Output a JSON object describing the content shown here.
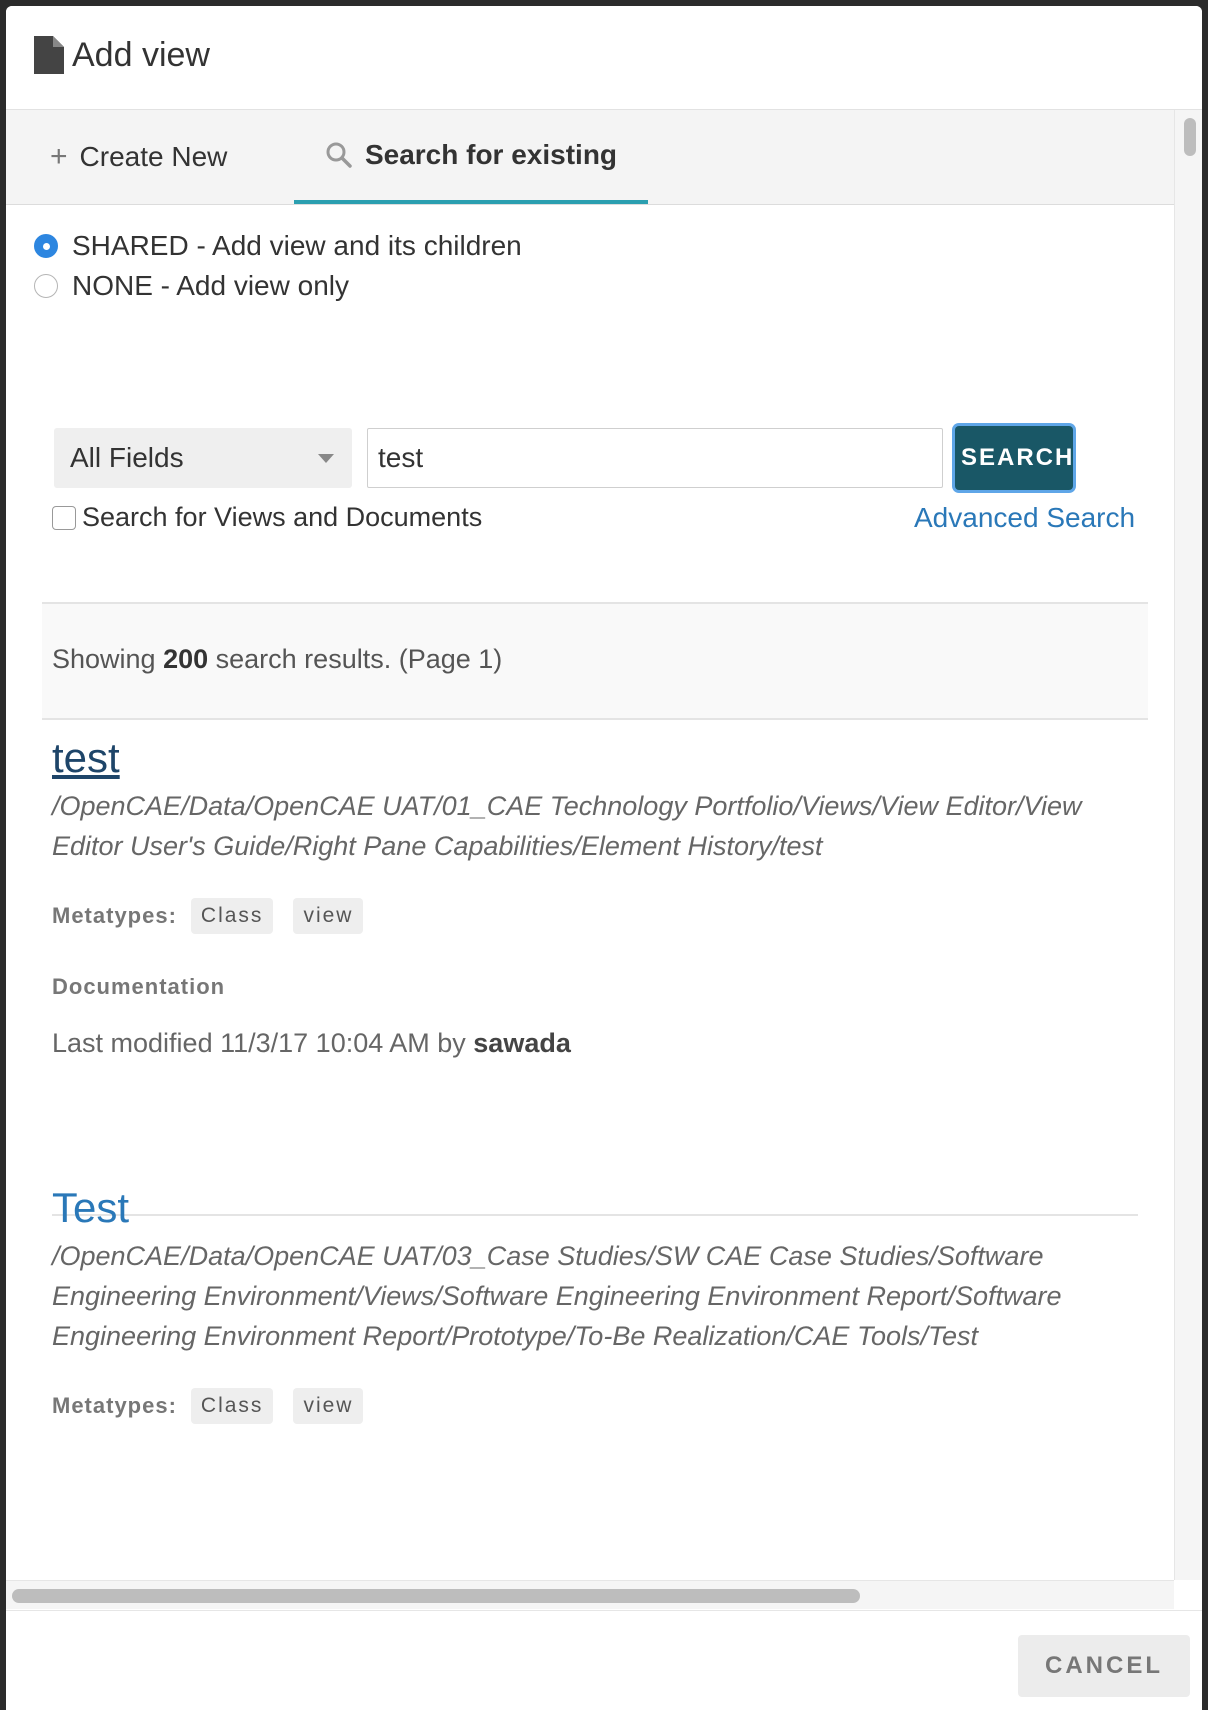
{
  "dialog": {
    "title": "Add view",
    "title_icon": "document-icon"
  },
  "tabs": [
    {
      "label": "Create New",
      "icon": "plus-icon",
      "active": false
    },
    {
      "label": "Search for existing",
      "icon": "search-icon",
      "active": true
    }
  ],
  "options": [
    {
      "label": "SHARED - Add view and its children",
      "selected": true
    },
    {
      "label": "NONE - Add view only",
      "selected": false
    }
  ],
  "search": {
    "field": "All Fields",
    "query": "test",
    "button": "SEARCH",
    "views_docs_label": "Search for Views and Documents",
    "views_docs_checked": false,
    "advanced": "Advanced Search"
  },
  "summary": {
    "prefix": "Showing ",
    "count": "200",
    "suffix": " search results. (Page 1)"
  },
  "results": [
    {
      "title": "test",
      "path": "/OpenCAE/Data/OpenCAE UAT/01_CAE Technology Portfolio/Views/View Editor/View Editor User's Guide/Right Pane Capabilities/Element History/test",
      "metatypes_label": "Metatypes:",
      "metatypes": [
        "Class",
        "view"
      ],
      "documentation_label": "Documentation",
      "modified_prefix": "Last modified 11/3/17 10:04 AM by ",
      "modified_by": "sawada"
    },
    {
      "title": "Test",
      "path": "/OpenCAE/Data/OpenCAE UAT/03_Case Studies/SW CAE Case Studies/Software Engineering Environment/Views/Software Engineering Environment Report/Software Engineering Environment Report/Prototype/To-Be Realization/CAE Tools/Test",
      "metatypes_label": "Metatypes:",
      "metatypes": [
        "Class",
        "view"
      ]
    }
  ],
  "footer": {
    "cancel": "CANCEL"
  },
  "colors": {
    "accent_tab": "#2b9fb0",
    "search_button": "#195766",
    "link": "#2a78b8",
    "radio_selected": "#2d86e0"
  }
}
